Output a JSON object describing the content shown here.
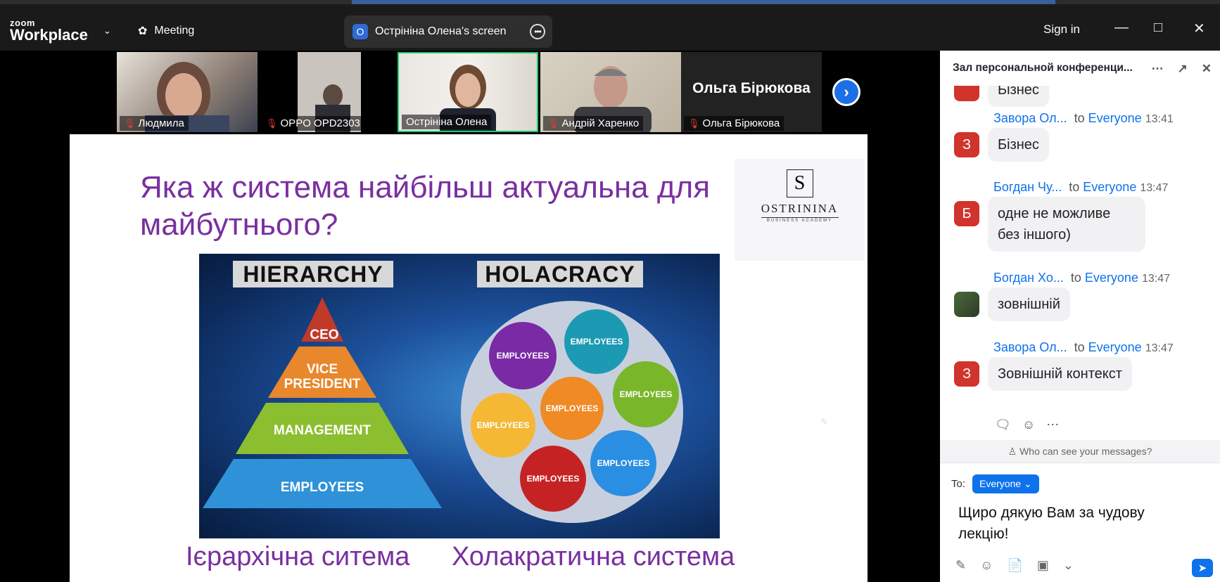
{
  "titlebar": {
    "brand_small": "zoom",
    "brand_big": "Workplace",
    "meeting_label": "Meeting",
    "share_badge": "O",
    "share_label": "Острініна Олена's screen",
    "sign_in": "Sign in"
  },
  "participants": [
    {
      "name": "Людмила",
      "muted": true
    },
    {
      "name": "OPPO OPD2303",
      "muted": true
    },
    {
      "name": "Острініна Олена",
      "muted": false,
      "active": true
    },
    {
      "name": "Андрій Харенко",
      "muted": true
    },
    {
      "name": "Ольга Бірюкова",
      "muted": true,
      "display_text": "Ольга Бірюкова"
    }
  ],
  "slide": {
    "title": "Яка ж система найбільш актуальна для майбутнього?",
    "brand_name": "OSTRININA",
    "brand_sub": "BUSINESS ACADEMY",
    "hierarchy_label": "HIERARCHY",
    "holacracy_label": "HOLACRACY",
    "pyramid": [
      "CEO",
      "VICE PRESIDENT",
      "MANAGEMENT",
      "EMPLOYEES"
    ],
    "circles_label": "EMPLOYEES",
    "caption_left": "Ієрархічна ситема",
    "caption_right": "Холакратична система"
  },
  "chat": {
    "title": "Зал персональной конференци...",
    "partial_msg": "Бізнес",
    "messages": [
      {
        "sender": "Завора Ол...",
        "to": "to",
        "recipient": "Everyone",
        "time": "13:41",
        "avatar": "З",
        "avatar_color": "#d0342c",
        "text": "Бізнес"
      },
      {
        "sender": "Богдан Чу...",
        "to": "to",
        "recipient": "Everyone",
        "time": "13:47",
        "avatar": "Б",
        "avatar_color": "#d0342c",
        "text": "одне не можливе без іншого)"
      },
      {
        "sender": "Богдан Хо...",
        "to": "to",
        "recipient": "Everyone",
        "time": "13:47",
        "avatar": "",
        "avatar_color": "#4a6a3a",
        "text": "зовнішній"
      },
      {
        "sender": "Завора Ол...",
        "to": "to",
        "recipient": "Everyone",
        "time": "13:47",
        "avatar": "З",
        "avatar_color": "#d0342c",
        "text": "Зовнішній контекст"
      }
    ],
    "privacy_note": "Who can see your messages?",
    "to_label": "To:",
    "recipient_button": "Everyone",
    "draft_text": "Щиро дякую Вам за чудову лекцію!"
  }
}
